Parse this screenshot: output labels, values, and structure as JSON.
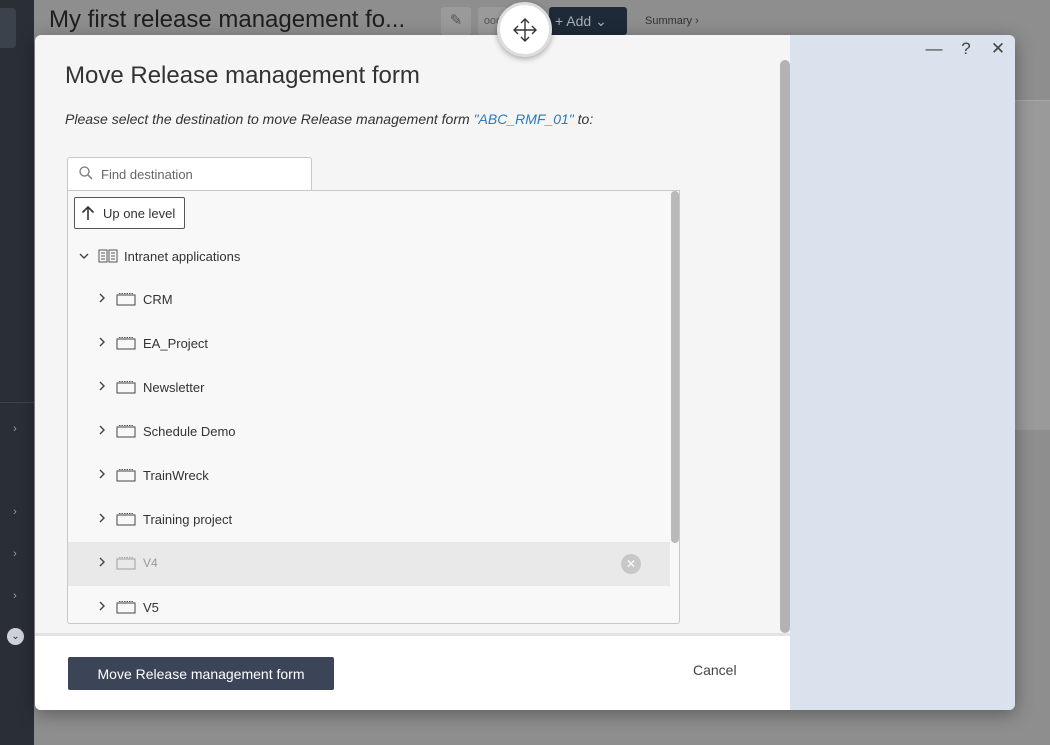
{
  "background": {
    "page_title": "My first release management fo...",
    "add_label": "+ Add",
    "summary_label": "Summary ›"
  },
  "dialog": {
    "title": "Move Release management form",
    "instruction_prefix": "Please select the destination to move Release management form ",
    "instruction_item": "\"ABC_RMF_01\"",
    "instruction_suffix": " to:",
    "window_controls": {
      "minimize": "—",
      "help": "?",
      "close": "✕"
    },
    "search": {
      "placeholder": "Find destination",
      "value": ""
    },
    "up_one_level": "Up one level",
    "tree": {
      "root": {
        "label": "Intranet applications",
        "icon": "book-icon",
        "expanded": true
      },
      "children": [
        {
          "label": "CRM",
          "icon": "folder-icon",
          "disabled": false
        },
        {
          "label": "EA_Project",
          "icon": "folder-icon",
          "disabled": false
        },
        {
          "label": "Newsletter",
          "icon": "folder-icon",
          "disabled": false
        },
        {
          "label": "Schedule Demo",
          "icon": "folder-icon",
          "disabled": false
        },
        {
          "label": "TrainWreck",
          "icon": "folder-icon",
          "disabled": false
        },
        {
          "label": "Training project",
          "icon": "folder-icon",
          "disabled": false
        },
        {
          "label": "V4",
          "icon": "folder-icon",
          "disabled": true
        },
        {
          "label": "V5",
          "icon": "folder-icon",
          "disabled": false
        }
      ]
    },
    "primary_button": "Move Release management form",
    "cancel_button": "Cancel"
  },
  "colors": {
    "primary": "#3b4557",
    "link": "#2a7bbd",
    "side_panel": "#d9e2ed"
  }
}
